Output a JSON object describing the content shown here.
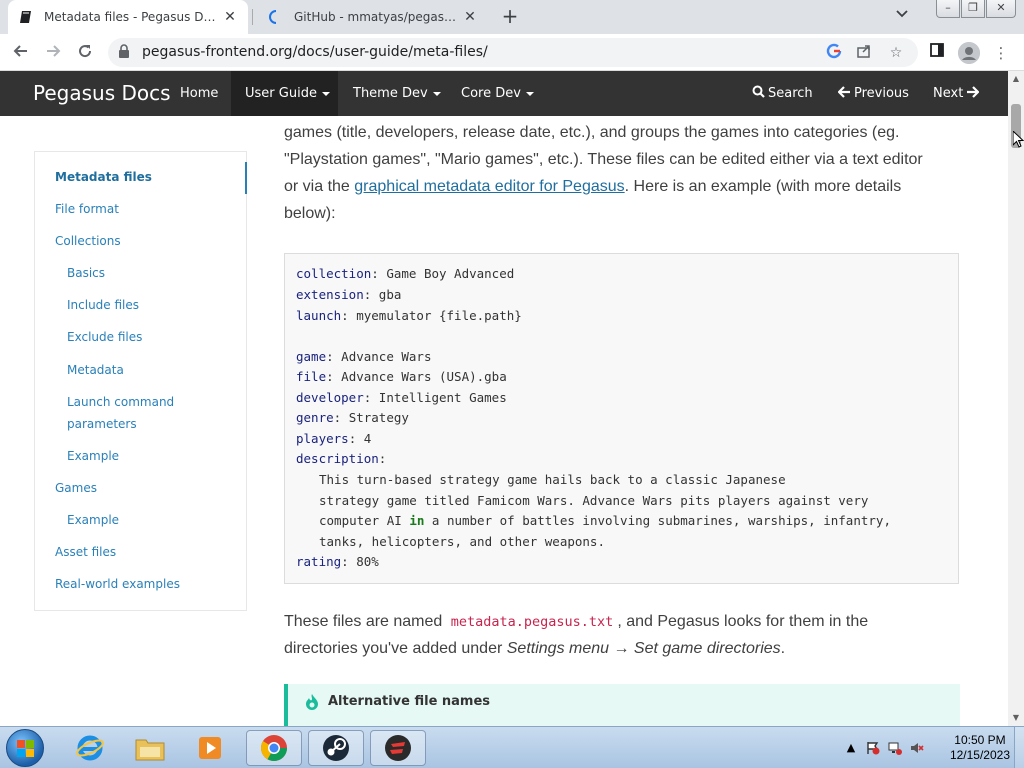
{
  "browser": {
    "tabs": [
      {
        "title": "Metadata files - Pegasus Docs",
        "active": true
      },
      {
        "title": "GitHub - mmatyas/pegasus-frontend",
        "active": false
      }
    ],
    "url": "pegasus-frontend.org/docs/user-guide/meta-files/",
    "newtab_label": "+",
    "close_glyph": "✕"
  },
  "sitenav": {
    "brand": "Pegasus Docs",
    "links": [
      {
        "label": "Home"
      },
      {
        "label": "User Guide"
      },
      {
        "label": "Theme Dev"
      },
      {
        "label": "Core Dev"
      }
    ],
    "search": "Search",
    "previous": "Previous",
    "next": "Next"
  },
  "toc": [
    {
      "label": "Metadata files"
    },
    {
      "label": "File format"
    },
    {
      "label": "Collections"
    },
    {
      "label": "Basics"
    },
    {
      "label": "Include files"
    },
    {
      "label": "Exclude files"
    },
    {
      "label": "Metadata"
    },
    {
      "label": "Launch command"
    },
    {
      "label": "parameters"
    },
    {
      "label": "Example"
    },
    {
      "label": "Games"
    },
    {
      "label": "Example"
    },
    {
      "label": "Asset files"
    },
    {
      "label": "Real-world examples"
    }
  ],
  "article": {
    "p1_line1": "games (title, developers, release date, etc.), and groups the games into categories (eg.",
    "p1_line2": "\"Playstation games\", \"Mario games\", etc.). These files can be edited either via a text editor",
    "p1_line3_pre": "or via the ",
    "p1_link": "graphical metadata editor for Pegasus",
    "p1_line3_post": ". Here is an example (with more details",
    "p1_line4": "below):",
    "code": [
      {
        "key": "collection",
        "value": "Game Boy Advanced"
      },
      {
        "key": "extension",
        "value": "gba"
      },
      {
        "key": "launch",
        "value": "myemulator {file.path}"
      },
      {
        "key": "game",
        "value": "Advance Wars"
      },
      {
        "key": "file",
        "value": "Advance Wars (USA).gba"
      },
      {
        "key": "developer",
        "value": "Intelligent Games"
      },
      {
        "key": "genre",
        "value": "Strategy"
      },
      {
        "key": "players",
        "value": "4"
      },
      {
        "key": "description",
        "value": ""
      },
      {
        "key": "rating",
        "value": "80%"
      }
    ],
    "desc_lines": [
      "This turn-based strategy game hails back to a classic Japanese",
      "strategy game titled Famicom Wars. Advance Wars pits players against very",
      "computer AI ",
      "tanks, helicopters, and other weapons."
    ],
    "desc_kw": "in",
    "desc_line3_post": " a number of battles involving submarines, warships, infantry,",
    "p2_pre": "These files are named ",
    "p2_code": "metadata.pegasus.txt",
    "p2_post": ", and Pegasus looks for them in the",
    "p3_pre": "directories you've added under ",
    "p3_em": "Settings menu → Set game directories",
    "p3_post": ".",
    "admonition_title": "Alternative file names"
  },
  "taskbar": {
    "time": "10:50 PM",
    "date": "12/15/2023",
    "apps": [
      "internet-explorer-icon",
      "windows-explorer-icon",
      "media-player-icon",
      "chrome-icon",
      "steam-icon",
      "app-icon"
    ]
  },
  "colors": {
    "nav_bg": "#333333",
    "link": "#2980b9",
    "admonition_border": "#1abc9c"
  }
}
